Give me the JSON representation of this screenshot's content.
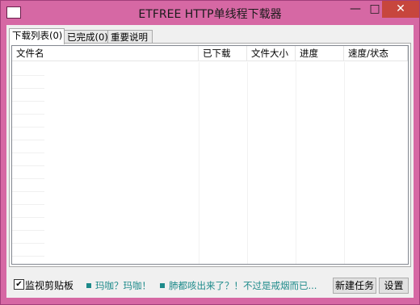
{
  "window": {
    "title": "ETFREE HTTP单线程下载器",
    "controls": {
      "minimize": "—",
      "maximize": "□",
      "close": "✕"
    }
  },
  "tabs": [
    {
      "label": "下载列表(0)",
      "active": true
    },
    {
      "label": "已完成(0)",
      "active": false
    },
    {
      "label": "重要说明",
      "active": false
    }
  ],
  "list": {
    "columns": [
      "文件名",
      "已下载",
      "文件大小",
      "进度",
      "速度/状态"
    ],
    "rows": []
  },
  "bottom": {
    "clipboard_checkbox": {
      "label": "监视剪贴板",
      "checked": true,
      "mark": "✔"
    },
    "marquee_1": "玛咖？玛咖！",
    "marquee_2": "肺都咳出来了？！不过是戒烟而已...",
    "new_task_button": "新建任务",
    "settings_button": "设置"
  },
  "colors": {
    "window_frame": "#d668a4",
    "close_button": "#c7463d",
    "marquee_text": "#1d8a8a"
  }
}
